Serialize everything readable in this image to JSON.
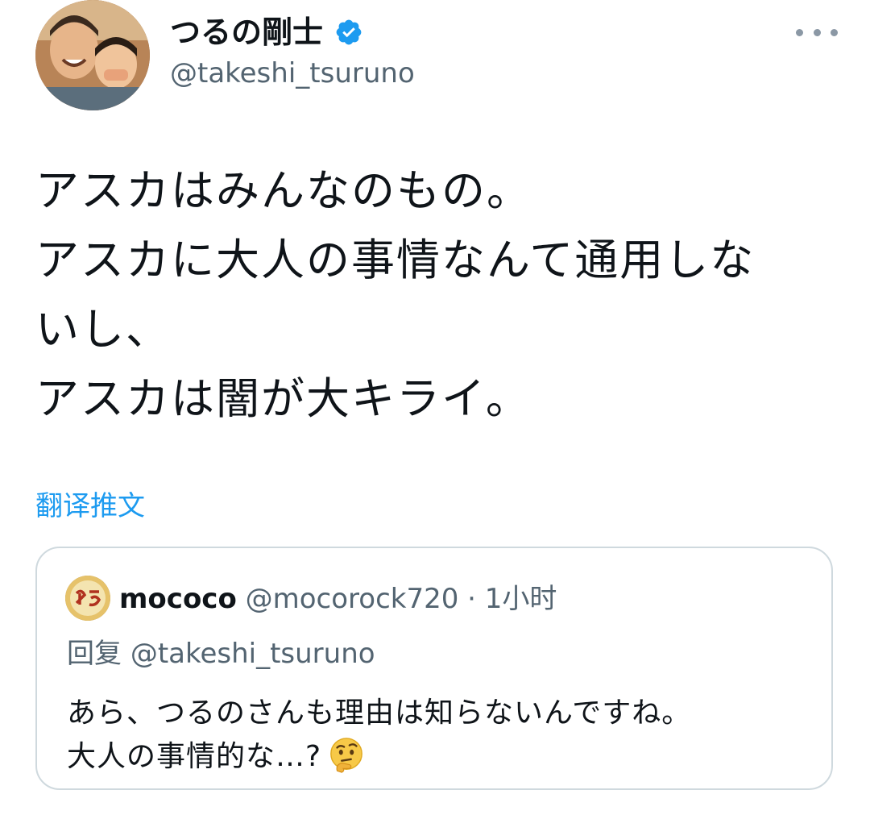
{
  "author": {
    "display_name": "つるの剛士",
    "handle": "@takeshi_tsuruno",
    "verified": true
  },
  "tweet": {
    "lines": [
      "アスカはみんなのもの。",
      "アスカに大人の事情なんて通用しな",
      "いし、",
      "アスカは闇が大キライ。"
    ],
    "translate_label": "翻译推文"
  },
  "quoted_tweet": {
    "display_name": "mococo",
    "handle": "@mocorock720",
    "separator": "·",
    "time": "1小时",
    "reply_prefix": "回复",
    "reply_handle": "@takeshi_tsuruno",
    "lines": [
      "あら、つるのさんも理由は知らないんですね。",
      "大人の事情的な…?"
    ],
    "emoji": "thinking-face"
  },
  "colors": {
    "accent": "#1d9bf0",
    "secondary_text": "#536471",
    "primary_text": "#0f1419",
    "card_border": "#cfd9de"
  },
  "icons": {
    "verified": "verified-badge-icon",
    "more": "more-options-icon",
    "emoji": "thinking-face-emoji-icon"
  }
}
